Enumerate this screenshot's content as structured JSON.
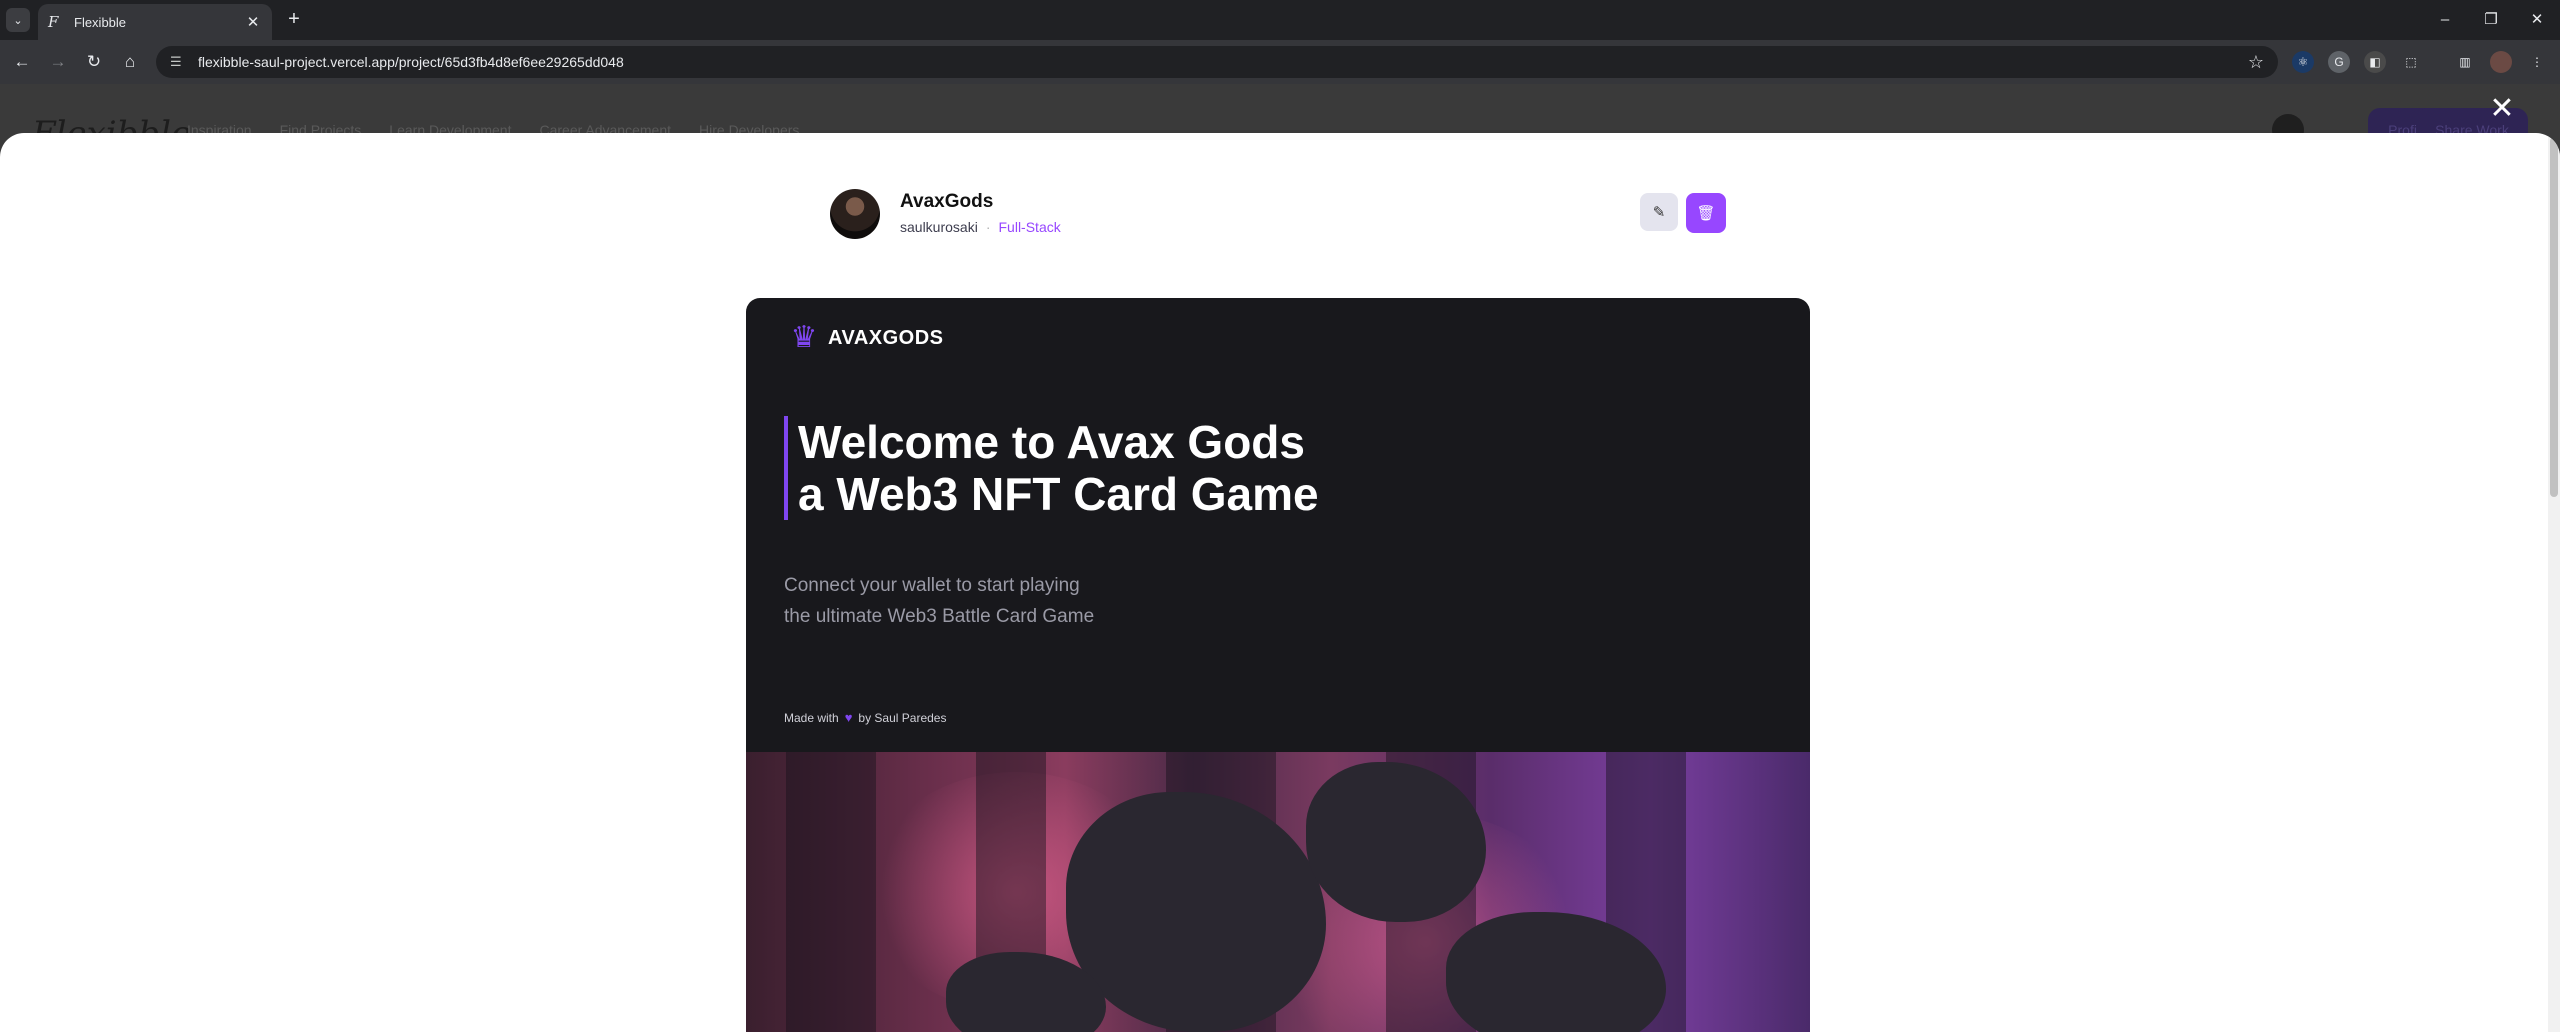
{
  "browser": {
    "tab_title": "Flexibble",
    "url": "flexibble-saul-project.vercel.app/project/65d3fb4d8ef6ee29265dd048",
    "colors": {
      "tabbar": "#202124",
      "toolbar": "#35363a"
    }
  },
  "background_page": {
    "logo": "Flexibble",
    "nav": [
      "Inspiration",
      "Find Projects",
      "Learn Development",
      "Career Advancement",
      "Hire Developers"
    ],
    "profile_label": "Profile",
    "share_label": "Share Work"
  },
  "project": {
    "title": "AvaxGods",
    "author": "saulkurosaki",
    "separator": "·",
    "category": "Full-Stack",
    "accent": "#9747ff"
  },
  "preview": {
    "logo_text": "AVAXGODS",
    "headline": [
      "Welcome to Avax Gods",
      "a Web3 NFT Card Game"
    ],
    "subtitle": [
      "Connect your wallet to start playing",
      "the ultimate Web3 Battle Card Game"
    ],
    "made_prefix": "Made with",
    "made_suffix": "by Saul Paredes",
    "accent": "#7f46f0"
  },
  "icons": [
    "tab-list-icon",
    "flexibble-favicon",
    "close-icon",
    "plus-icon",
    "minimize-icon",
    "restore-icon",
    "back-arrow-icon",
    "forward-arrow-icon",
    "reload-icon",
    "home-icon",
    "site-settings-icon",
    "star-icon",
    "extension-icon",
    "sidebar-icon",
    "profile-avatar",
    "menu-dots-icon",
    "edit-icon",
    "trash-icon",
    "heart-icon",
    "lion-logo-icon"
  ]
}
